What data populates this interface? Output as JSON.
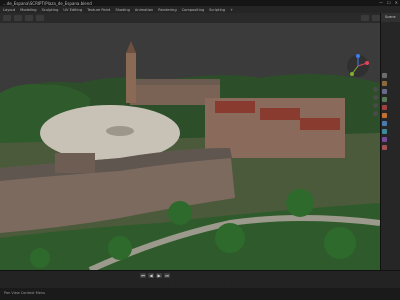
{
  "window": {
    "title": "...de_Espana\\SCRIPT\\Plaza_de_Espana.blend",
    "controls": [
      "—",
      "☐",
      "✕"
    ]
  },
  "menubar": {
    "items": [
      "Layout",
      "Modeling",
      "Sculpting",
      "UV Editing",
      "Texture Paint",
      "Shading",
      "Animation",
      "Rendering",
      "Compositing",
      "Scripting",
      "+"
    ]
  },
  "outliner": {
    "scene_label": "Scene"
  },
  "timeline": {
    "play_buttons": [
      "⏮",
      "◀",
      "▶",
      "⏭"
    ]
  },
  "statusbar": {
    "text": "Pan View   Context Menu"
  },
  "colors": {
    "sky": "#3b3b3b",
    "vegetation": "#2e5a2a",
    "building": "#7a6355",
    "roof": "#8a3b30",
    "plaza": "#c8c2b6"
  }
}
